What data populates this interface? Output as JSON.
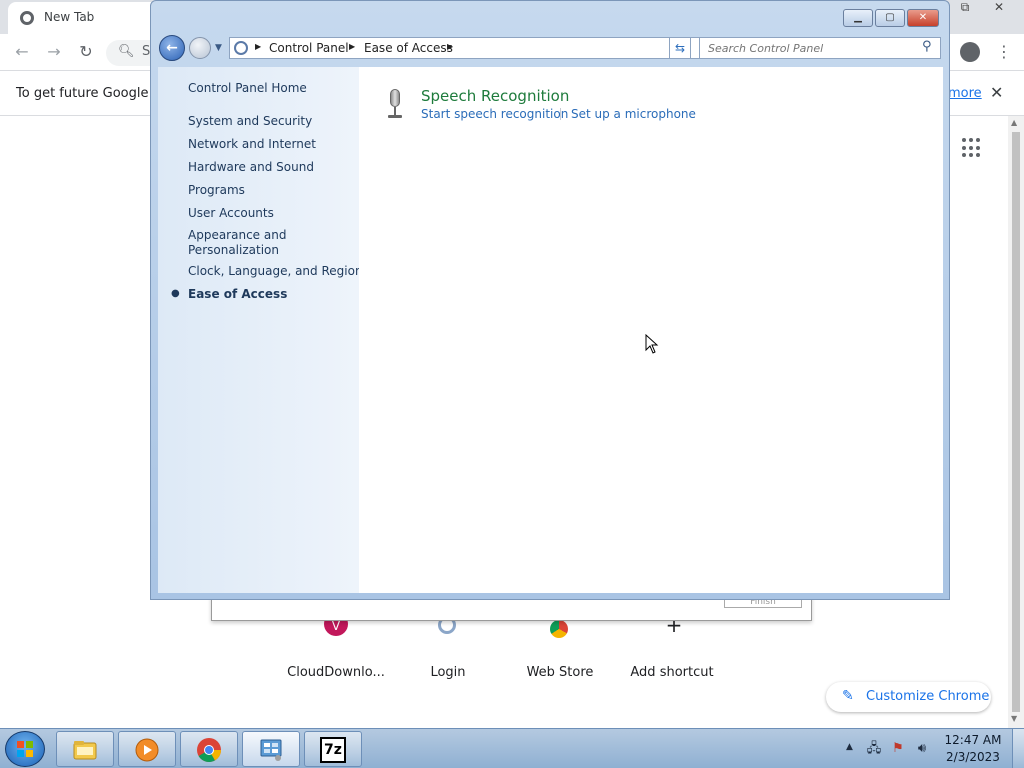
{
  "chrome": {
    "tab_title": "New Tab",
    "omnibox_text": "S",
    "infobar_text": "To get future Google Ch",
    "infobar_link": "more",
    "infobar_close": "✕",
    "shortcuts": [
      {
        "label": "CloudDownlo...",
        "letter": "V",
        "color": "#c2185b"
      },
      {
        "label": "Login",
        "letter": "",
        "color": "#ffffff"
      },
      {
        "label": "Web Store",
        "letter": "",
        "color": "#ffffff"
      },
      {
        "label": "Add shortcut",
        "letter": "+",
        "color": "#ffffff"
      }
    ],
    "customize_label": "Customize Chrome",
    "behind_dialog_button": "Finish"
  },
  "control_panel": {
    "breadcrumb": [
      "Control Panel",
      "Ease of Access"
    ],
    "search_placeholder": "Search Control Panel",
    "sidebar": {
      "home": "Control Panel Home",
      "items": [
        "System and Security",
        "Network and Internet",
        "Hardware and Sound",
        "Programs",
        "User Accounts",
        "Appearance and Personalization",
        "Clock, Language, and Region",
        "Ease of Access"
      ],
      "active_index": 7
    },
    "main": {
      "section_title": "Speech Recognition",
      "links": [
        "Start speech recognition",
        "Set up a microphone"
      ]
    }
  },
  "taskbar": {
    "time": "12:47 AM",
    "date": "2/3/2023",
    "buttons": [
      "Windows Explorer",
      "Windows Media Player",
      "Google Chrome",
      "Control Panel",
      "7-Zip"
    ],
    "seven_zip_label": "7z"
  },
  "colors": {
    "link_blue": "#2a6cb8",
    "section_green": "#1e7b3c",
    "chrome_accent": "#1a73e8"
  }
}
